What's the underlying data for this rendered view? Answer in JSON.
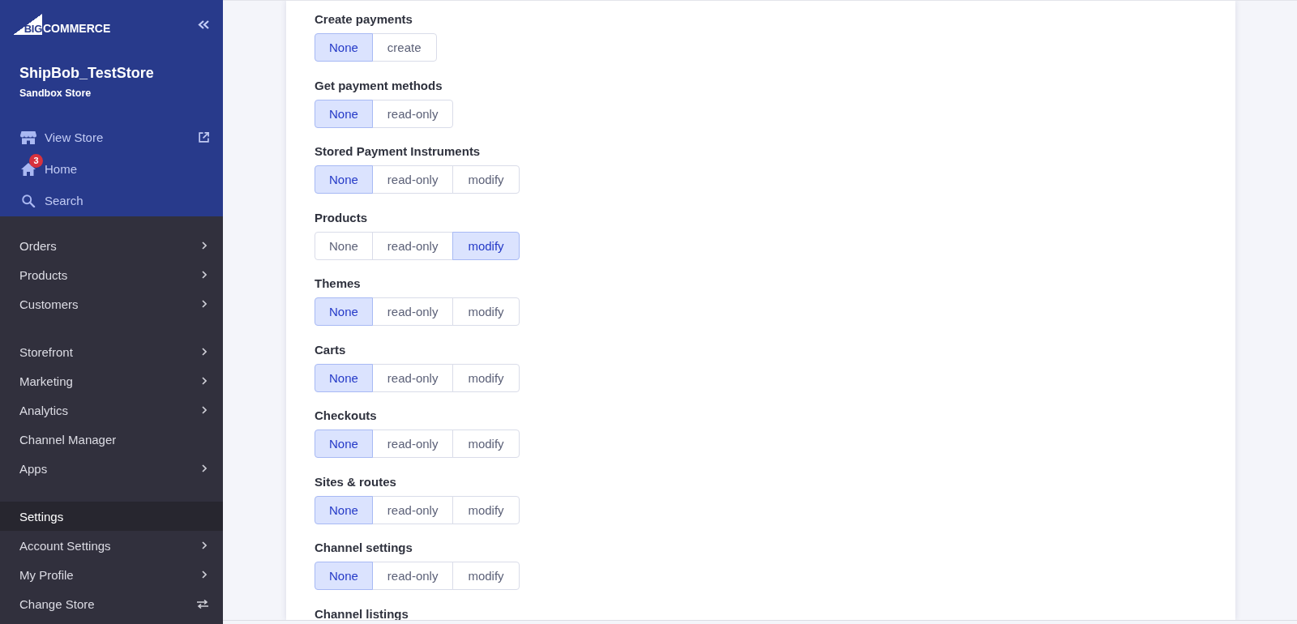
{
  "sidebar": {
    "logo": {
      "mark": "BIG",
      "wordmark": "COMMERCE"
    },
    "store": {
      "name": "ShipBob_TestStore",
      "subtitle": "Sandbox Store"
    },
    "quick_links": [
      {
        "kind": "store",
        "label": "View Store",
        "external": true
      },
      {
        "kind": "home",
        "label": "Home",
        "badge": "3",
        "external": false
      },
      {
        "kind": "search",
        "label": "Search",
        "external": false
      }
    ],
    "nav_groups": [
      {
        "items": [
          {
            "kind": "submenu",
            "label": "Orders",
            "selected": false
          },
          {
            "kind": "submenu",
            "label": "Products",
            "selected": false
          },
          {
            "kind": "submenu",
            "label": "Customers",
            "selected": false
          }
        ]
      },
      {
        "items": [
          {
            "kind": "submenu",
            "label": "Storefront",
            "selected": false
          },
          {
            "kind": "submenu",
            "label": "Marketing",
            "selected": false
          },
          {
            "kind": "submenu",
            "label": "Analytics",
            "selected": false
          },
          {
            "kind": "link",
            "label": "Channel Manager",
            "selected": false
          },
          {
            "kind": "submenu",
            "label": "Apps",
            "selected": false
          }
        ]
      },
      {
        "items": [
          {
            "kind": "link",
            "label": "Settings",
            "selected": true
          },
          {
            "kind": "submenu",
            "label": "Account Settings",
            "selected": false
          },
          {
            "kind": "submenu",
            "label": "My Profile",
            "selected": false
          },
          {
            "kind": "switch",
            "label": "Change Store",
            "selected": false
          }
        ]
      }
    ]
  },
  "permissions": [
    {
      "label": "Create payments",
      "options": [
        {
          "label": "None",
          "selected": true
        },
        {
          "label": "create",
          "selected": false
        }
      ]
    },
    {
      "label": "Get payment methods",
      "options": [
        {
          "label": "None",
          "selected": true
        },
        {
          "label": "read-only",
          "selected": false
        }
      ]
    },
    {
      "label": "Stored Payment Instruments",
      "options": [
        {
          "label": "None",
          "selected": true
        },
        {
          "label": "read-only",
          "selected": false
        },
        {
          "label": "modify",
          "selected": false
        }
      ]
    },
    {
      "label": "Products",
      "options": [
        {
          "label": "None",
          "selected": false
        },
        {
          "label": "read-only",
          "selected": false
        },
        {
          "label": "modify",
          "selected": true
        }
      ]
    },
    {
      "label": "Themes",
      "options": [
        {
          "label": "None",
          "selected": true
        },
        {
          "label": "read-only",
          "selected": false
        },
        {
          "label": "modify",
          "selected": false
        }
      ]
    },
    {
      "label": "Carts",
      "options": [
        {
          "label": "None",
          "selected": true
        },
        {
          "label": "read-only",
          "selected": false
        },
        {
          "label": "modify",
          "selected": false
        }
      ]
    },
    {
      "label": "Checkouts",
      "options": [
        {
          "label": "None",
          "selected": true
        },
        {
          "label": "read-only",
          "selected": false
        },
        {
          "label": "modify",
          "selected": false
        }
      ]
    },
    {
      "label": "Sites & routes",
      "options": [
        {
          "label": "None",
          "selected": true
        },
        {
          "label": "read-only",
          "selected": false
        },
        {
          "label": "modify",
          "selected": false
        }
      ]
    },
    {
      "label": "Channel settings",
      "options": [
        {
          "label": "None",
          "selected": true
        },
        {
          "label": "read-only",
          "selected": false
        },
        {
          "label": "modify",
          "selected": false
        }
      ]
    },
    {
      "label": "Channel listings"
    }
  ]
}
